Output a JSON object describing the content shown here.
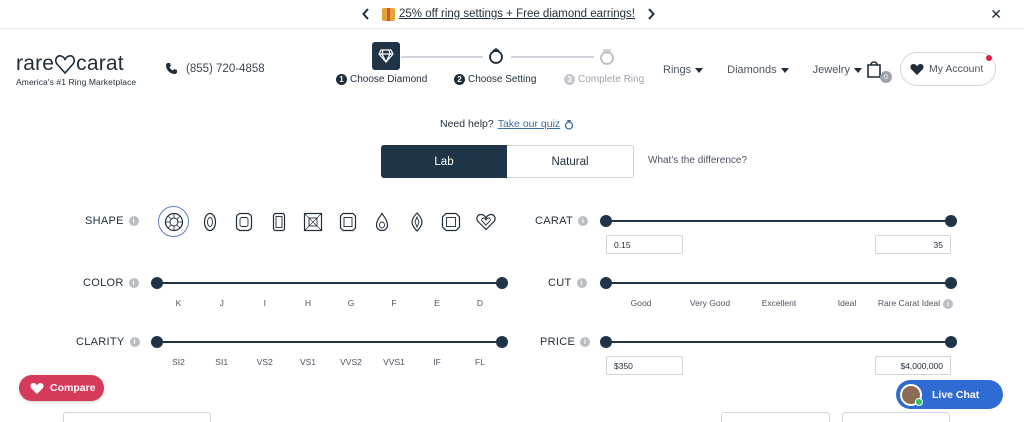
{
  "promo": {
    "text": "25% off ring settings + Free diamond earrings!",
    "prev_icon": "chevron-left-icon",
    "next_icon": "chevron-right-icon",
    "gift_icon": "gift-icon",
    "close_icon": "close-icon"
  },
  "brand": {
    "name_left": "rare",
    "name_right": "carat",
    "tagline": "America's #1 Ring Marketplace"
  },
  "phone": {
    "number": "(855) 720-4858"
  },
  "steps": [
    {
      "num": "1",
      "label": "Choose Diamond",
      "icon": "diamond-icon",
      "state": "active"
    },
    {
      "num": "2",
      "label": "Choose Setting",
      "icon": "ring-setting-icon",
      "state": "normal"
    },
    {
      "num": "3",
      "label": "Complete Ring",
      "icon": "ring-icon",
      "state": "muted"
    }
  ],
  "nav": {
    "items": [
      {
        "label": "Rings"
      },
      {
        "label": "Diamonds"
      },
      {
        "label": "Jewelry"
      }
    ],
    "cart_count": "0",
    "account_label": "My Account"
  },
  "help": {
    "prefix": "Need help?",
    "link": "Take our quiz"
  },
  "toggle": {
    "lab": "Lab",
    "natural": "Natural",
    "selected": "Lab",
    "difference": "What's the difference?"
  },
  "filters": {
    "shape": {
      "label": "SHAPE",
      "shapes": [
        "round",
        "oval",
        "cushion",
        "emerald",
        "princess",
        "radiant",
        "pear",
        "marquise",
        "asscher",
        "heart"
      ],
      "selected": "round"
    },
    "carat": {
      "label": "CARAT",
      "min": "0.15",
      "max": "35"
    },
    "color": {
      "label": "COLOR",
      "grades": [
        "K",
        "J",
        "I",
        "H",
        "G",
        "F",
        "E",
        "D"
      ]
    },
    "cut": {
      "label": "CUT",
      "grades": [
        "Good",
        "Very Good",
        "Excellent",
        "Ideal",
        "Rare Carat Ideal"
      ]
    },
    "clarity": {
      "label": "CLARITY",
      "grades": [
        "SI2",
        "SI1",
        "VS2",
        "VS1",
        "VVS2",
        "VVS1",
        "IF",
        "FL"
      ]
    },
    "price": {
      "label": "PRICE",
      "min": "$350",
      "max": "$4,000,000"
    }
  },
  "compare_label": "Compare",
  "livechat_label": "Live Chat",
  "colors": {
    "navy": "#1f3447",
    "compare": "#d63a5a",
    "chat": "#2f6bd3",
    "link": "#3a6ea5"
  }
}
